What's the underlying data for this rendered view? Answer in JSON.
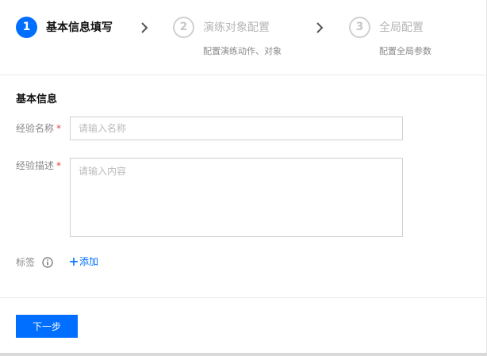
{
  "steps": [
    {
      "number": "1",
      "title": "基本信息填写",
      "description": "",
      "state": "active"
    },
    {
      "number": "2",
      "title": "演练对象配置",
      "description": "配置演练动作、对象",
      "state": "inactive"
    },
    {
      "number": "3",
      "title": "全局配置",
      "description": "配置全局参数",
      "state": "inactive"
    }
  ],
  "icons": {
    "step_separator": "chevron-right-icon",
    "tag_help": "info-icon",
    "add": "plus-icon"
  },
  "colors": {
    "primary": "#006eff",
    "required": "#e54545",
    "inactive": "#c8c8c8"
  },
  "form": {
    "section_title": "基本信息",
    "name": {
      "label": "经验名称",
      "required_mark": "*",
      "value": "",
      "placeholder": "请输入名称"
    },
    "description": {
      "label": "经验描述",
      "required_mark": "*",
      "value": "",
      "placeholder": "请输入内容"
    },
    "tags": {
      "label": "标签",
      "add_label": "添加"
    }
  },
  "footer": {
    "next_label": "下一步"
  }
}
